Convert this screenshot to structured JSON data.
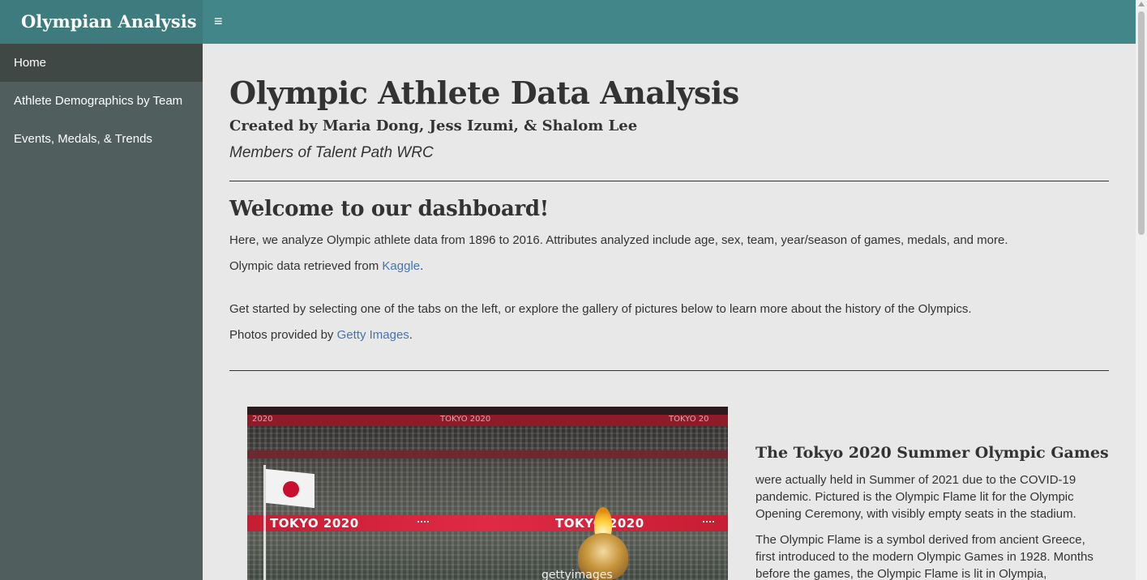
{
  "app": {
    "brand": "Olympian Analysis",
    "menu_icon": "hamburger-icon"
  },
  "sidebar": {
    "items": [
      {
        "label": "Home",
        "active": true
      },
      {
        "label": "Athlete Demographics by Team",
        "active": false
      },
      {
        "label": "Events, Medals, & Trends",
        "active": false
      }
    ]
  },
  "main": {
    "title": "Olympic Athlete Data Analysis",
    "subtitle": "Created by Maria Dong, Jess Izumi, & Shalom Lee",
    "members": "Members of Talent Path WRC",
    "welcome": "Welcome to our dashboard!",
    "intro": "Here, we analyze Olympic athlete data from 1896 to 2016. Attributes analyzed include age, sex, team, year/season of games, medals, and more.",
    "source_prefix": "Olympic data retrieved from ",
    "source_link": "Kaggle",
    "source_suffix": ".",
    "get_started": "Get started by selecting one of the tabs on the left, or explore the gallery of pictures below to learn more about the history of the Olympics.",
    "photos_prefix": "Photos provided by ",
    "photos_link": "Getty Images",
    "photos_suffix": "."
  },
  "gallery": {
    "photo": {
      "banner_left": "TOKYO 2020",
      "banner_right": "TOKYO 2020",
      "top_banner_1": "2020",
      "top_banner_2": "TOKYO 2020",
      "top_banner_3": "TOKYO 20",
      "watermark": "gettyimages"
    },
    "caption_title": "The Tokyo 2020 Summer Olympic Games",
    "caption_1": "were actually held in Summer of 2021 due to the COVID-19 pandemic. Pictured is the Olympic Flame lit for the Olympic Opening Ceremony, with visibly empty seats in the stadium.",
    "caption_2": "The Olympic Flame is a symbol derived from ancient Greece, first introduced to the modern Olympic Games in 1928. Months before the games, the Olympic Flame is lit in Olympia,"
  },
  "colors": {
    "topbar": "#43868a",
    "brand_bg": "#3e7b7f",
    "sidebar": "#505e5d",
    "sidebar_active": "#404846",
    "content_bg": "#e8e8e8",
    "link": "#4673b0"
  }
}
